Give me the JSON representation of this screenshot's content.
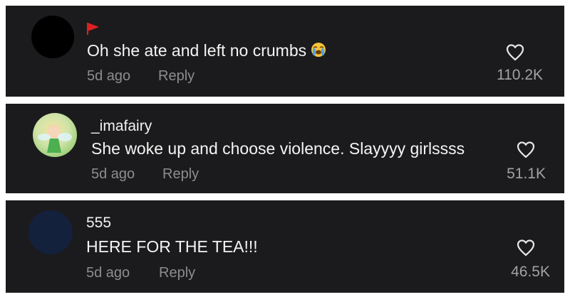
{
  "comments": [
    {
      "username": "",
      "flag_icon": "red-flag-icon",
      "text": "Oh she ate and left no crumbs",
      "emoji": "loudly-crying-face-icon",
      "age": "5d ago",
      "reply_label": "Reply",
      "likes": "110.2K",
      "avatar_color": "#000000"
    },
    {
      "username": "_imafairy",
      "text": "She woke up and choose violence. Slayyyy girlssss",
      "age": "5d ago",
      "reply_label": "Reply",
      "likes": "51.1K",
      "avatar_color": "#cfe3a8"
    },
    {
      "username": "555",
      "text": "HERE FOR THE TEA!!!",
      "age": "5d ago",
      "reply_label": "Reply",
      "likes": "46.5K",
      "avatar_color": "#14213d"
    }
  ],
  "colors": {
    "card_bg": "#1b1b1d",
    "meta_text": "#8d8d90",
    "flag": "#e02020"
  }
}
